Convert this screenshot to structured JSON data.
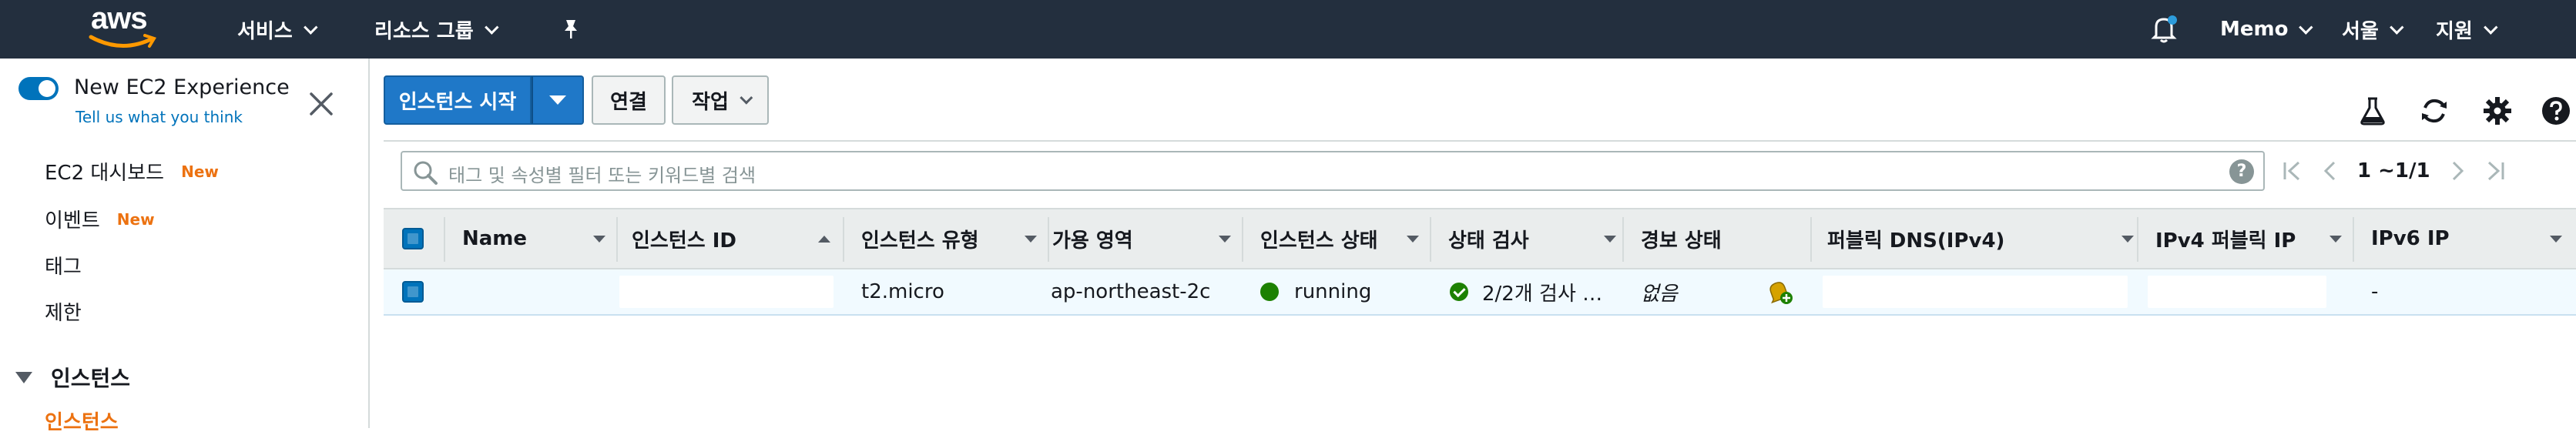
{
  "topnav": {
    "logo": "aws",
    "services": "서비스",
    "resource_groups": "리소스 그룹",
    "account": "Memo",
    "region": "서울",
    "support": "지원",
    "notification_dot_color": "#2d9cdb"
  },
  "sidebar": {
    "toggle_label": "New EC2 Experience",
    "toggle_link": "Tell us what you think",
    "toggle_on": true,
    "items": [
      {
        "label": "EC2 대시보드",
        "badge": "New"
      },
      {
        "label": "이벤트",
        "badge": "New"
      },
      {
        "label": "태그"
      },
      {
        "label": "제한"
      }
    ],
    "section_title": "인스턴스",
    "active_item": "인스턴스"
  },
  "toolbar": {
    "launch": "인스턴스 시작",
    "connect": "연결",
    "actions": "작업"
  },
  "search": {
    "placeholder": "태그 및 속성별 필터 또는 키워드별 검색",
    "help": "?"
  },
  "pagination": {
    "range": "1 ~1/1"
  },
  "table": {
    "columns": [
      "Name",
      "인스턴스 ID",
      "인스턴스 유형",
      "가용 영역",
      "인스턴스 상태",
      "상태 검사",
      "경보 상태",
      "퍼블릭 DNS(IPv4)",
      "IPv4 퍼블릭 IP",
      "IPv6 IP"
    ],
    "rows": [
      {
        "name": "",
        "instance_id": "",
        "type": "t2.micro",
        "zone": "ap-northeast-2c",
        "state": "running",
        "status_check": "2/2개 검사 …",
        "alarm": "없음",
        "public_dns": "",
        "public_ip": "",
        "ipv6": "-"
      }
    ]
  },
  "colors": {
    "header_bg": "#232f3e",
    "primary": "#1f78c8",
    "accent_orange": "#ec7211",
    "running_green": "#1d8102"
  }
}
